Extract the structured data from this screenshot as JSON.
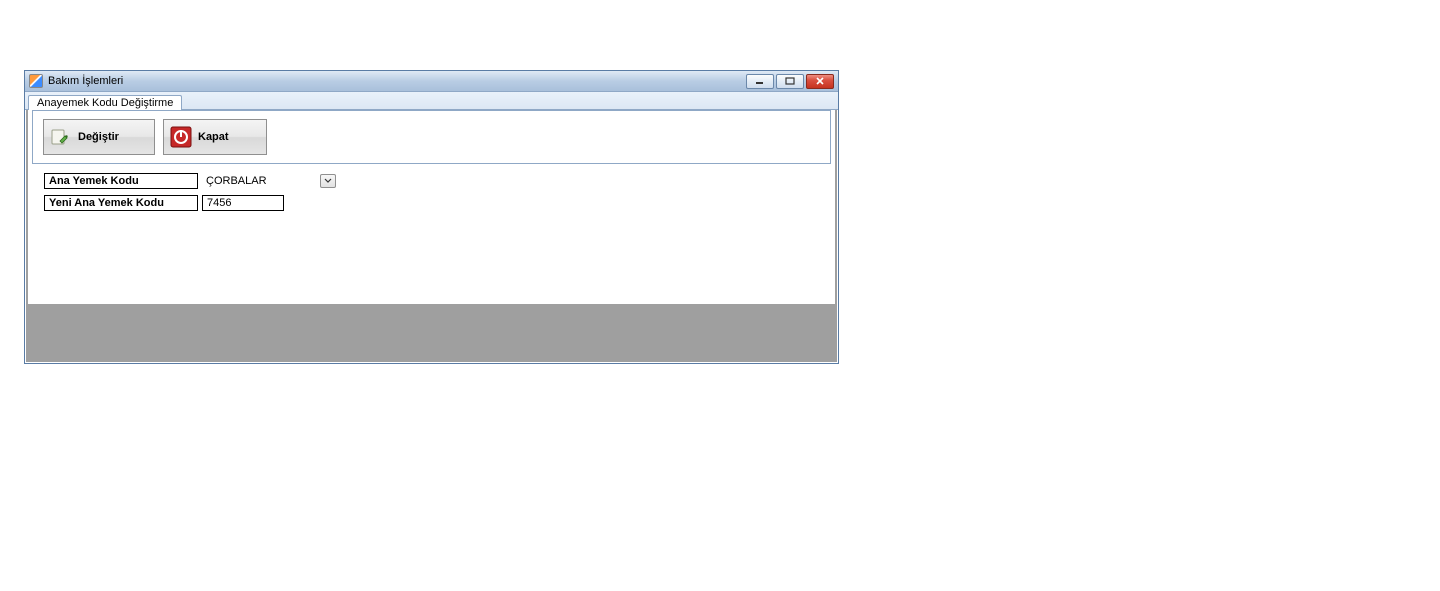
{
  "window": {
    "title": "Bakım İşlemleri"
  },
  "tabs": [
    {
      "label": "Anayemek Kodu Değiştirme"
    }
  ],
  "toolbar": {
    "change_label": "Değiştir",
    "close_label": "Kapat"
  },
  "form": {
    "ana_yemek_kodu_label": "Ana Yemek Kodu",
    "ana_yemek_kodu_value": "ÇORBALAR",
    "yeni_ana_yemek_kodu_label": "Yeni Ana Yemek Kodu",
    "yeni_ana_yemek_kodu_value": "7456"
  }
}
